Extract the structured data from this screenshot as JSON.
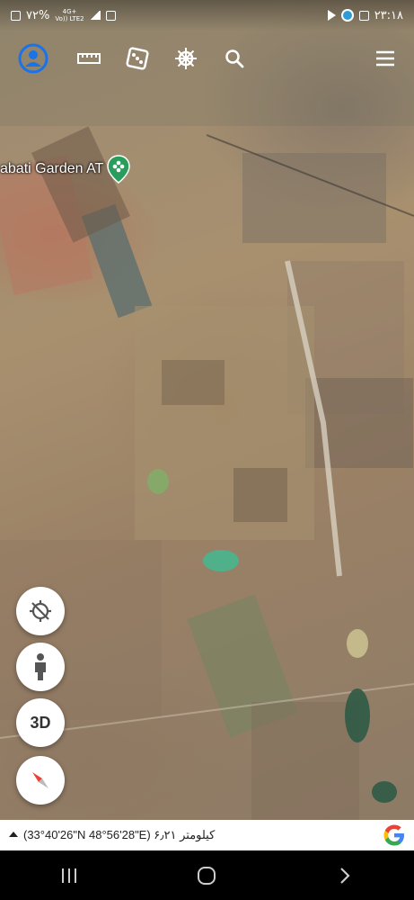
{
  "status_bar": {
    "battery": "٧٢%",
    "network_top": "4G+",
    "network_bottom": "Vo)) LTE2",
    "time": "٢٣:١٨"
  },
  "toolbar": {
    "profile_icon": "profile-icon",
    "measure_icon": "ruler-icon",
    "random_icon": "dice-icon",
    "voyager_icon": "ship-wheel-icon",
    "search_icon": "search-icon",
    "menu_icon": "hamburger-menu-icon"
  },
  "map": {
    "place_label": "abati Garden AT",
    "place_icon": "garden-pin-icon"
  },
  "floating_controls": {
    "location_icon": "gps-off-icon",
    "streetview_icon": "pegman-icon",
    "view_3d_label": "3D",
    "compass_icon": "compass-icon"
  },
  "info_bar": {
    "coordinates": "(33°40'26\"N 48°56'28\"E) ۶٫۲۱ کیلومتر",
    "logo": "G"
  },
  "colors": {
    "accent_blue": "#1a73e8",
    "google_blue": "#4285F4",
    "google_red": "#EA4335",
    "google_yellow": "#FBBC05",
    "google_green": "#34A853"
  }
}
